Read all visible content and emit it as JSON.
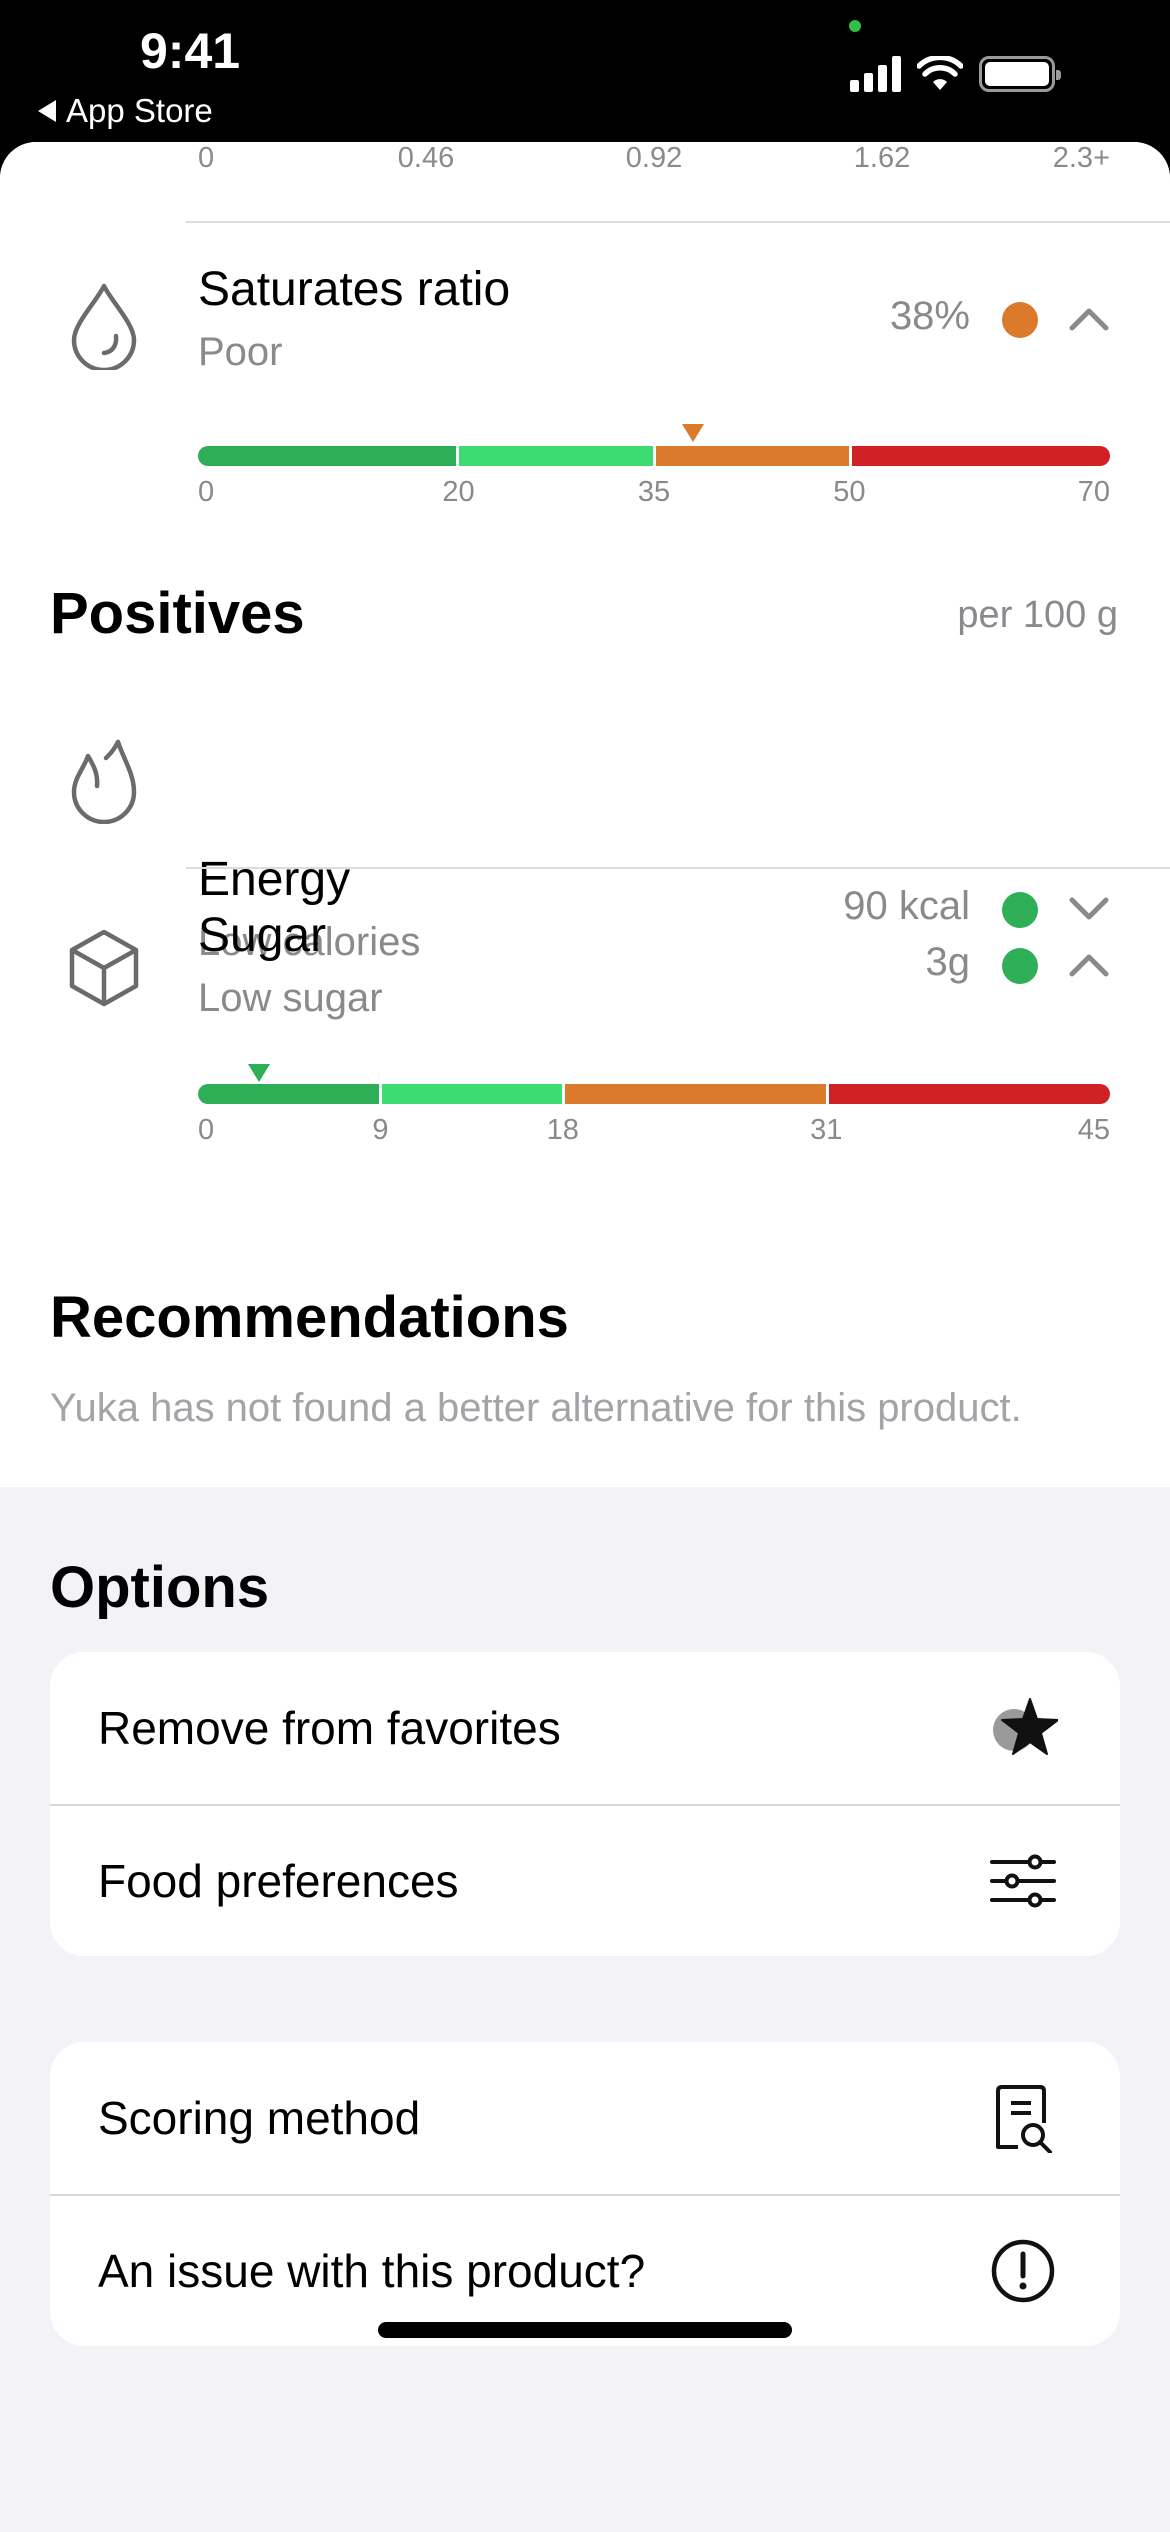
{
  "status_bar": {
    "time": "9:41",
    "back_app_label": "App Store",
    "icons": [
      "signal-icon",
      "wifi-icon",
      "battery-icon"
    ]
  },
  "top_scale": {
    "ticks": [
      "0",
      "0.46",
      "0.92",
      "1.62",
      "2.3+"
    ]
  },
  "negatives": {
    "items": [
      {
        "name": "Saturates ratio",
        "subtitle": "Poor",
        "value": "38%",
        "status_color": "#dc7a2c",
        "expanded": true,
        "icon": "drop-icon",
        "scale": {
          "ticks": [
            "0",
            "20",
            "35",
            "50",
            "70"
          ],
          "tick_values": [
            0,
            20,
            35,
            50,
            70
          ],
          "segment_colors": [
            "#2fae58",
            "#3ddc73",
            "#dc7a2c",
            "#d02127"
          ],
          "marker_value": 38,
          "marker_color": "#dc7a2c"
        }
      }
    ]
  },
  "positives": {
    "title": "Positives",
    "unit_label": "per 100 g",
    "items": [
      {
        "name": "Energy",
        "subtitle": "Low calories",
        "value": "90 kcal",
        "status_color": "#2fae58",
        "expanded": false,
        "icon": "flame-icon"
      },
      {
        "name": "Sugar",
        "subtitle": "Low sugar",
        "value": "3g",
        "status_color": "#2fae58",
        "expanded": true,
        "icon": "sugar-cube-icon",
        "scale": {
          "ticks": [
            "0",
            "9",
            "18",
            "31",
            "45"
          ],
          "tick_values": [
            0,
            9,
            18,
            31,
            45
          ],
          "segment_colors": [
            "#2fae58",
            "#3ddc73",
            "#dc7a2c",
            "#d02127"
          ],
          "marker_value": 3,
          "marker_color": "#2fae58"
        }
      }
    ]
  },
  "recommendations": {
    "title": "Recommendations",
    "message": "Yuka has not found a better alternative for this product."
  },
  "options": {
    "title": "Options",
    "group1": [
      {
        "label": "Remove from favorites",
        "icon": "star-icon"
      },
      {
        "label": "Food preferences",
        "icon": "sliders-icon"
      }
    ],
    "group2": [
      {
        "label": "Scoring method",
        "icon": "document-search-icon"
      },
      {
        "label": "An issue with this product?",
        "icon": "exclamation-circle-icon"
      }
    ]
  }
}
